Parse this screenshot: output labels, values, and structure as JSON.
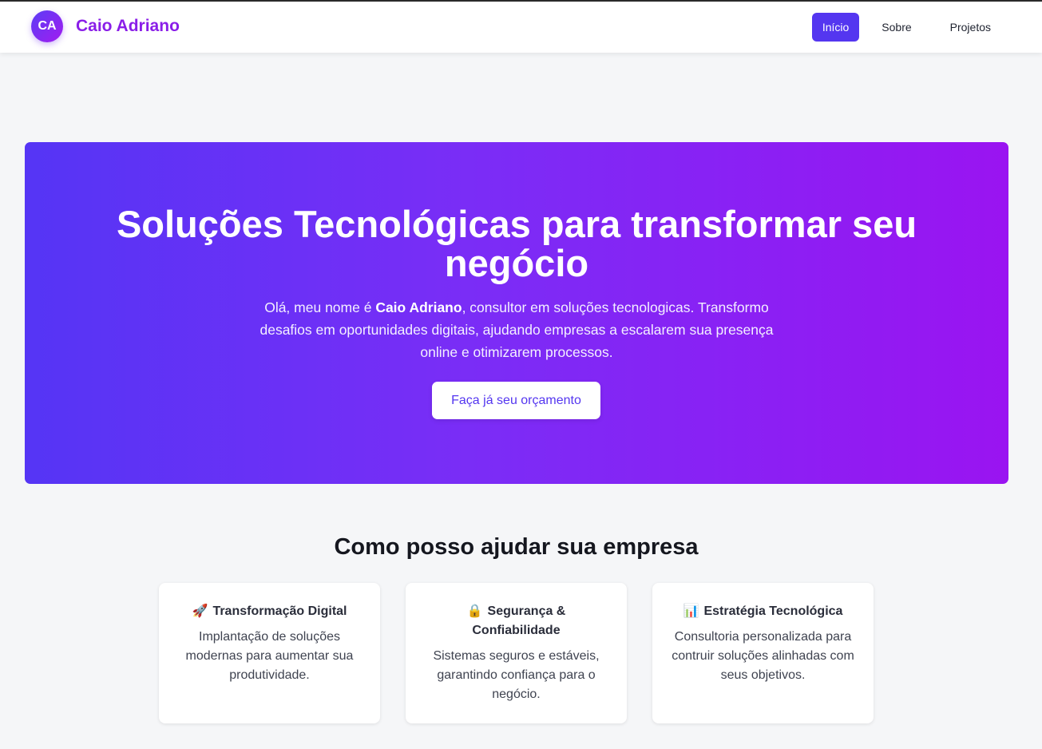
{
  "header": {
    "avatar_initials": "CA",
    "brand_name": "Caio Adriano",
    "nav": [
      {
        "label": "Início",
        "active": true
      },
      {
        "label": "Sobre",
        "active": false
      },
      {
        "label": "Projetos",
        "active": false
      }
    ]
  },
  "hero": {
    "title": "Soluções Tecnológicas para transformar seu negócio",
    "intro_before": "Olá, meu nome é ",
    "intro_name": "Caio Adriano",
    "intro_after": ", consultor em soluções tecnologicas. Transformo desafios em oportunidades digitais, ajudando empresas a escalarem sua presença online e otimizarem processos.",
    "cta_label": "Faça já seu orçamento"
  },
  "services": {
    "title": "Como posso ajudar sua empresa",
    "cards": [
      {
        "icon": "🚀",
        "icon_name": "rocket-icon",
        "title": "Transformação Digital",
        "text": "Implantação de soluções modernas para aumentar sua produtividade."
      },
      {
        "icon": "🔒",
        "icon_name": "lock-icon",
        "title": "Segurança & Confiabilidade",
        "text": "Sistemas seguros e estáveis, garantindo confiança para o negócio."
      },
      {
        "icon": "📊",
        "icon_name": "chart-icon",
        "title": "Estratégia Tecnológica",
        "text": "Consultoria personalizada para contruir soluções alinhadas com seus objetivos."
      }
    ]
  },
  "colors": {
    "accent": "#5436f0",
    "brand_text": "#8a1ee8",
    "hero_gradient_start": "#5535f5",
    "hero_gradient_end": "#9a14f1"
  }
}
